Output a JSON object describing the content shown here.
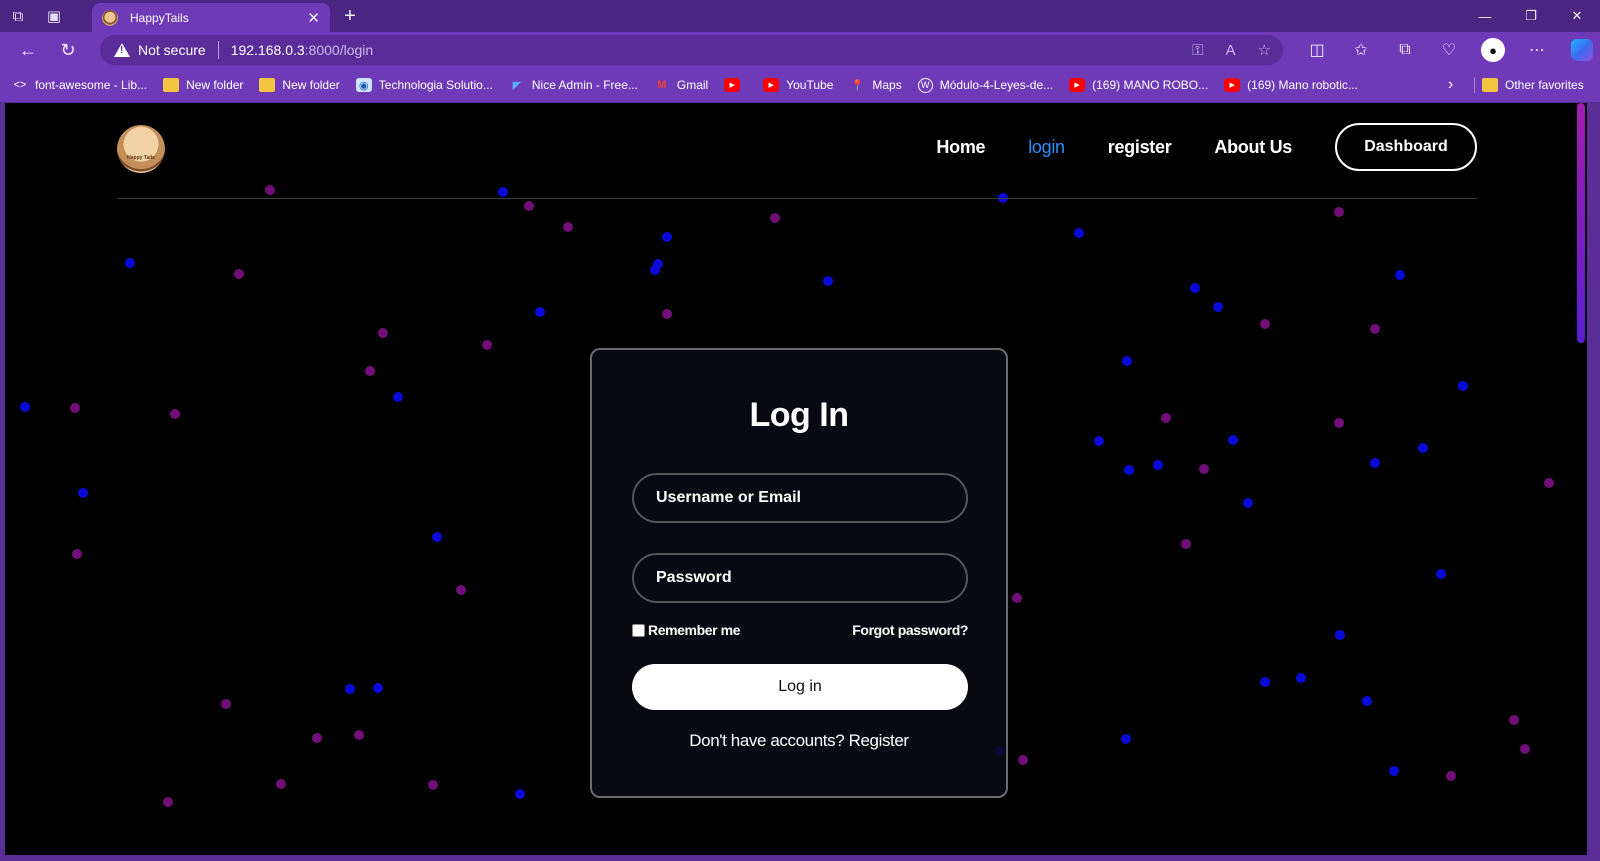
{
  "browser": {
    "tab_title": "HappyTails",
    "tab_close": "✕",
    "new_tab": "+",
    "not_secure": "Not secure",
    "url_host": "192.168.0.3",
    "url_rest": ":8000/login",
    "window_controls": {
      "minimize": "—",
      "restore": "❐",
      "close": "✕"
    }
  },
  "bookmarks": [
    {
      "label": "font-awesome - Lib...",
      "icon": "code-icon"
    },
    {
      "label": "New folder",
      "icon": "folder-icon"
    },
    {
      "label": "New folder",
      "icon": "folder-icon"
    },
    {
      "label": "Technologia Solutio...",
      "icon": "globe-icon"
    },
    {
      "label": "Nice Admin - Free...",
      "icon": "flutter-icon"
    },
    {
      "label": "Gmail",
      "icon": "gmail-icon"
    },
    {
      "label": "",
      "icon": "youtube-icon"
    },
    {
      "label": "YouTube",
      "icon": "youtube-icon"
    },
    {
      "label": "Maps",
      "icon": "maps-icon"
    },
    {
      "label": "Módulo-4-Leyes-de...",
      "icon": "wordpress-icon"
    },
    {
      "label": "(169) MANO ROBO...",
      "icon": "youtube-icon"
    },
    {
      "label": "(169) Mano robotic...",
      "icon": "youtube-icon"
    }
  ],
  "bookmarks_other": "Other favorites",
  "site": {
    "logo_text": "Happy Tails",
    "nav": {
      "home": "Home",
      "login": "login",
      "register": "register",
      "about": "About Us",
      "dashboard": "Dashboard"
    }
  },
  "login": {
    "title": "Log In",
    "username_placeholder": "Username or Email",
    "password_placeholder": "Password",
    "remember": "Remember me",
    "forgot": "Forgot password?",
    "submit": "Log in",
    "register_prompt": "Don't have accounts? Register"
  },
  "colors": {
    "chrome": "#6f3ab8",
    "particle_blue": "#0a0ad8",
    "particle_purple": "#720e78",
    "active_link": "#2d8cff"
  }
}
